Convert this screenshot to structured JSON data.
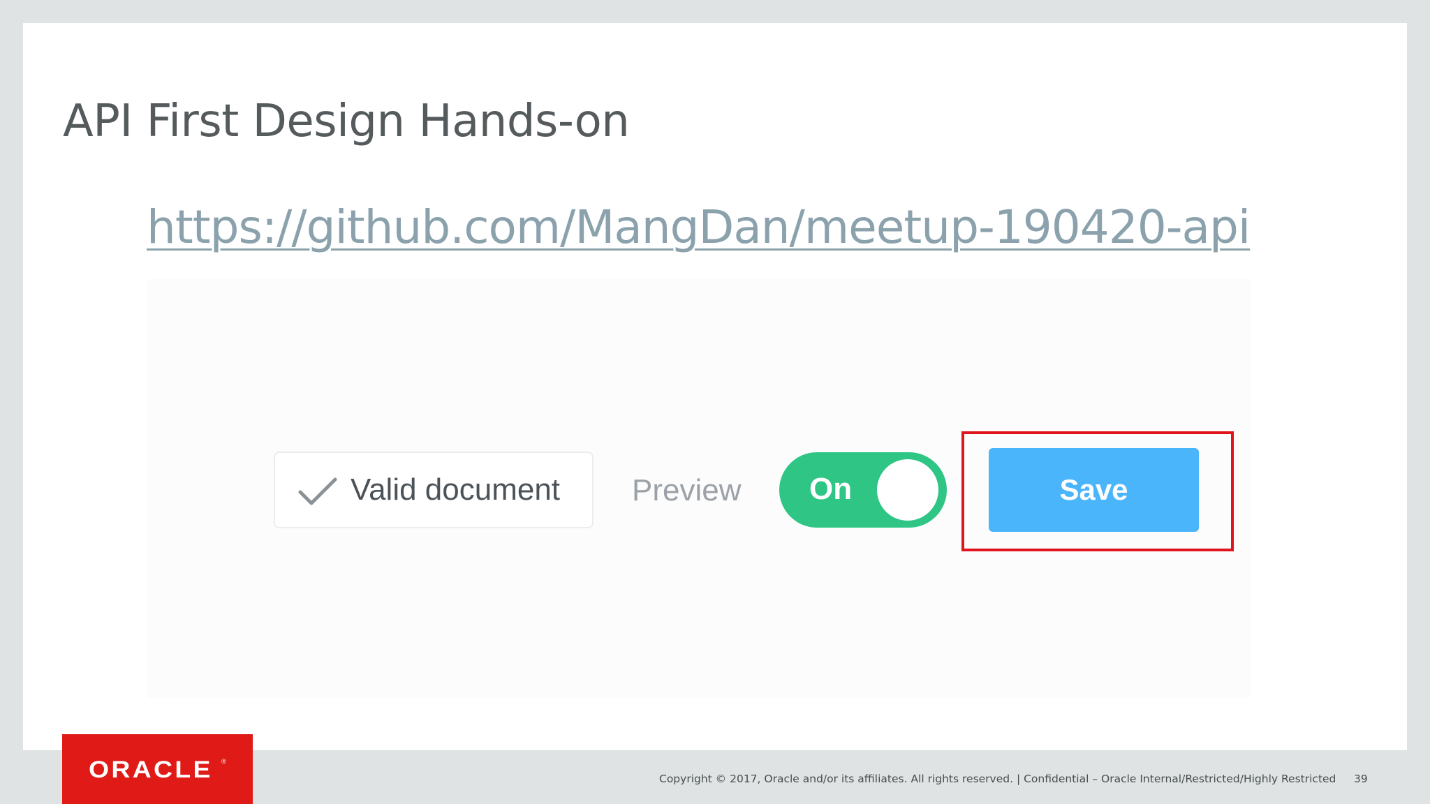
{
  "slide": {
    "title": "API First Design Hands-on",
    "link": "https://github.com/MangDan/meetup-190420-api"
  },
  "editor_toolbar": {
    "validation_status": "Valid document",
    "preview_label": "Preview",
    "preview_toggle_state": "On",
    "save_label": "Save"
  },
  "footer": {
    "logo_text": "ORACLE",
    "logo_mark": "®",
    "copyright": "Copyright © 2017, Oracle and/or its affiliates. All rights reserved.  |  Confidential – Oracle Internal/Restricted/Highly Restricted",
    "page_number": "39"
  },
  "colors": {
    "toggle_on": "#2ec585",
    "save_button": "#4bb5fb",
    "highlight": "#e0141c",
    "oracle_red": "#e01a16",
    "link": "#8ba2ad"
  },
  "icons": {
    "validation": "check-icon"
  }
}
